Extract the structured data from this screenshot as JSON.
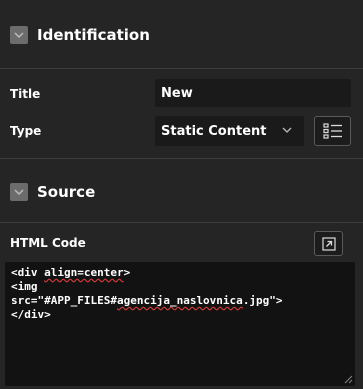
{
  "identification": {
    "title": "Identification",
    "fields": {
      "title_label": "Title",
      "title_value": "New",
      "type_label": "Type",
      "type_value": "Static Content"
    }
  },
  "source": {
    "title": "Source",
    "html_code_label": "HTML Code",
    "code": {
      "line1_a": "<div ",
      "line1_b": "align=center",
      "line1_c": ">",
      "line2": "<img",
      "line3_a": "src=\"#APP_FILES#",
      "line3_b": "agencija_naslovnica",
      "line3_c": ".jpg\">",
      "line4": "</div>"
    }
  },
  "icons": {
    "section_toggle": "chevron-down-icon",
    "type_list": "list-icon",
    "expand_editor": "expand-icon",
    "resize_handle": "resize-grip-icon"
  },
  "colors": {
    "background": "#252526",
    "field": "#1a1a1a",
    "spellcheck": "#d43a3a"
  }
}
